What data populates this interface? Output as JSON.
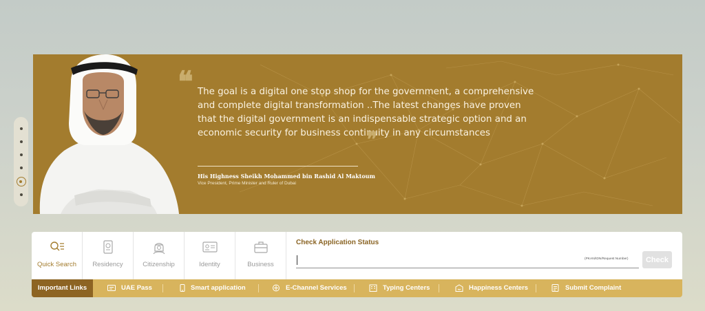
{
  "banner": {
    "quote": "The goal is a digital one stop shop for the government,  a comprehensive and complete digital transformation ..The latest changes have proven that the digital government is an indispensable strategic option and an economic security for business continuity in any circumstances",
    "author": "His Highness Sheikh Mohammed bin Rashid Al Maktoum",
    "role": "Vice President, Prime Minister and Ruler of Dubai",
    "color": "#a37c2e"
  },
  "slider": {
    "count": 6,
    "active_index": 5
  },
  "services": [
    {
      "label": "Quick Search",
      "icon": "quick-search-icon",
      "active": true
    },
    {
      "label": "Residency",
      "icon": "passport-icon",
      "active": false
    },
    {
      "label": "Citizenship",
      "icon": "citizen-icon",
      "active": false
    },
    {
      "label": "Identity",
      "icon": "id-card-icon",
      "active": false
    },
    {
      "label": "Business",
      "icon": "briefcase-icon",
      "active": false
    }
  ],
  "status": {
    "title": "Check Application Status",
    "hint": "(PKAN/IDN/Request Number)",
    "input_value": "",
    "button": "Check"
  },
  "links": {
    "title": "Important Links",
    "items": [
      {
        "label": "UAE Pass",
        "icon": "uae-pass-icon"
      },
      {
        "label": "Smart application",
        "icon": "smartphone-icon"
      },
      {
        "label": "E-Channel Services",
        "icon": "e-channel-icon"
      },
      {
        "label": "Typing Centers",
        "icon": "building-icon"
      },
      {
        "label": "Happiness Centers",
        "icon": "happiness-center-icon"
      },
      {
        "label": "Submit Complaint",
        "icon": "complaint-icon"
      }
    ]
  },
  "colors": {
    "gold": "#a37c2e",
    "gold_light": "#d8b45d",
    "gold_dark": "#8d6423"
  }
}
